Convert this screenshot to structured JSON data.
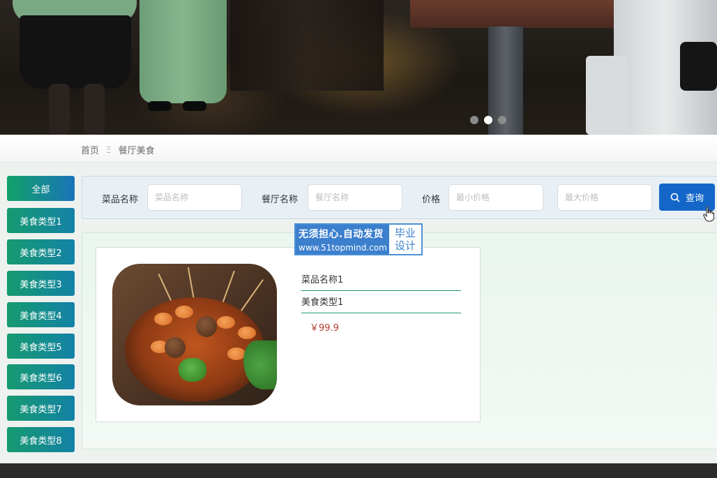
{
  "banner": {
    "slides": 3,
    "active_slide": 2
  },
  "breadcrumb": {
    "home": "首页",
    "separator": "Ξ",
    "current": "餐厅美食"
  },
  "sidebar": {
    "items": [
      {
        "label": "全部"
      },
      {
        "label": "美食类型1"
      },
      {
        "label": "美食类型2"
      },
      {
        "label": "美食类型3"
      },
      {
        "label": "美食类型4"
      },
      {
        "label": "美食类型5"
      },
      {
        "label": "美食类型6"
      },
      {
        "label": "美食类型7"
      },
      {
        "label": "美食类型8"
      }
    ]
  },
  "filter": {
    "dish_label": "菜品名称",
    "dish_placeholder": "菜品名称",
    "restaurant_label": "餐厅名称",
    "restaurant_placeholder": "餐厅名称",
    "price_label": "价格",
    "min_placeholder": "最小价格",
    "max_placeholder": "最大价格",
    "search_label": "查询"
  },
  "products": [
    {
      "name": "菜品名称1",
      "type": "美食类型1",
      "price": "￥99.9"
    }
  ],
  "watermark": {
    "line1": "无须担心.自动发货",
    "line2": "www.51topmind.com",
    "right_top": "毕业",
    "right_bottom": "设计"
  },
  "colors": {
    "accent_green": "#169a70",
    "accent_blue": "#1467c8",
    "price_red": "#b03a2e"
  }
}
